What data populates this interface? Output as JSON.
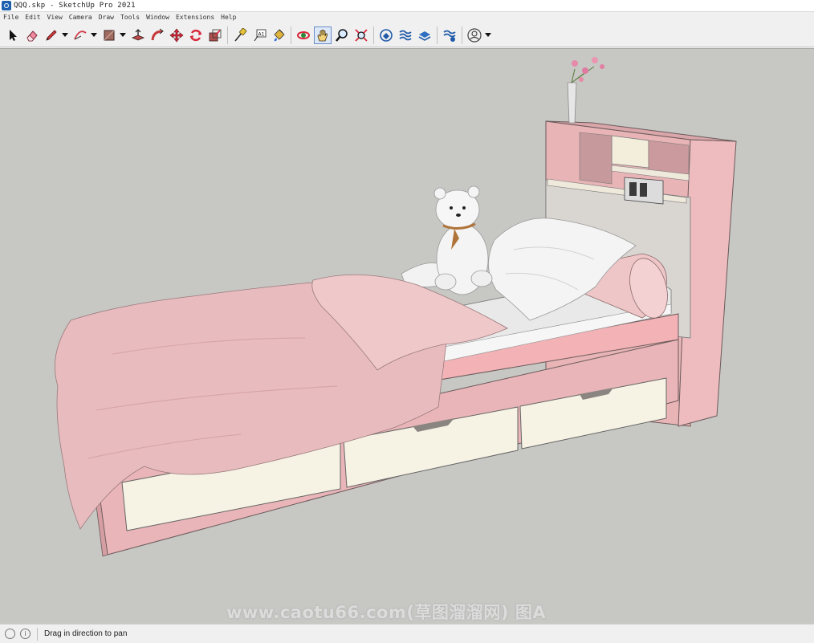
{
  "window": {
    "title": "QQQ.skp - SketchUp Pro 2021"
  },
  "menu": [
    "File",
    "Edit",
    "View",
    "Camera",
    "Draw",
    "Tools",
    "Window",
    "Extensions",
    "Help"
  ],
  "toolbar": {
    "tools": [
      {
        "name": "select-tool",
        "icon": "arrow-cursor-icon"
      },
      {
        "name": "eraser-tool",
        "icon": "eraser-icon"
      },
      {
        "name": "pencil-tool",
        "icon": "pencil-icon",
        "dropdown": true
      },
      {
        "name": "arc-tool",
        "icon": "arc-icon",
        "dropdown": true
      },
      {
        "name": "shape-tool",
        "icon": "rectangle-icon",
        "dropdown": true
      },
      {
        "name": "push-pull-tool",
        "icon": "push-pull-icon"
      },
      {
        "name": "follow-me-tool",
        "icon": "follow-me-icon"
      },
      {
        "name": "move-tool",
        "icon": "move-icon"
      },
      {
        "name": "rotate-tool",
        "icon": "rotate-icon"
      },
      {
        "name": "scale-tool",
        "icon": "scale-icon"
      },
      {
        "name": "tape-measure-tool",
        "icon": "tape-measure-icon"
      },
      {
        "name": "text-tool",
        "icon": "text-label-icon",
        "label": "A1"
      },
      {
        "name": "paint-bucket-tool",
        "icon": "paint-bucket-icon"
      },
      {
        "name": "orbit-tool",
        "icon": "orbit-icon"
      },
      {
        "name": "pan-tool",
        "icon": "pan-hand-icon",
        "active": true
      },
      {
        "name": "zoom-tool",
        "icon": "zoom-icon"
      },
      {
        "name": "zoom-extents-tool",
        "icon": "zoom-extents-icon"
      },
      {
        "name": "warehouse-tool",
        "icon": "warehouse-icon"
      },
      {
        "name": "extension-warehouse-tool",
        "icon": "extension-warehouse-icon"
      },
      {
        "name": "layout-tool",
        "icon": "layout-icon"
      },
      {
        "name": "extension-manager-tool",
        "icon": "extension-manager-icon"
      },
      {
        "name": "account-tool",
        "icon": "user-account-icon",
        "dropdown": true
      }
    ]
  },
  "viewport": {
    "watermark": "www.caotu66.com(草图溜溜网) 图A"
  },
  "status": {
    "info_icon": "i",
    "text": "Drag in direction to pan"
  },
  "colors": {
    "frame_pink": "#e9b5b8",
    "drawer_cream": "#f6f2e4",
    "sky": "#c7c7c4"
  }
}
